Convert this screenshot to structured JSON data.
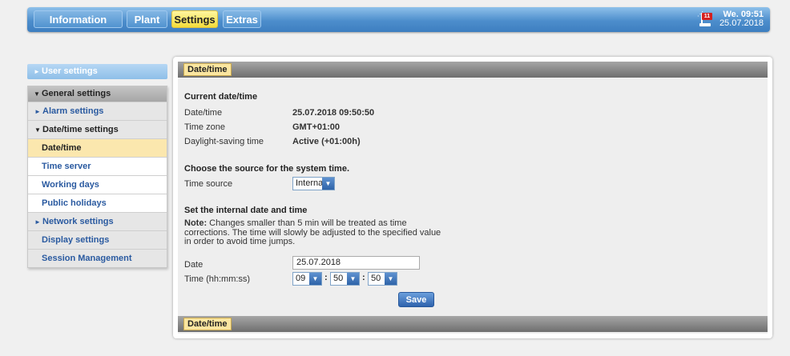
{
  "nav": {
    "tabs": [
      {
        "label": "Information"
      },
      {
        "label": "Plant"
      },
      {
        "label": "Settings"
      },
      {
        "label": "Extras"
      }
    ],
    "alarm_count": "11",
    "clock_time": "We. 09:51",
    "clock_date": "25.07.2018"
  },
  "sidebar": {
    "user_settings": "User settings",
    "general_settings": "General settings",
    "alarm_settings": "Alarm settings",
    "datetime_settings": "Date/time settings",
    "datetime": "Date/time",
    "time_server": "Time server",
    "working_days": "Working days",
    "public_holidays": "Public holidays",
    "network_settings": "Network settings",
    "display_settings": "Display settings",
    "session_management": "Session Management"
  },
  "panel": {
    "tab_label": "Date/time",
    "current_heading": "Current date/time",
    "rows": [
      {
        "label": "Date/time",
        "value": "25.07.2018 09:50:50"
      },
      {
        "label": "Time zone",
        "value": "GMT+01:00"
      },
      {
        "label": "Daylight-saving time",
        "value": "Active (+01:00h)"
      }
    ],
    "source_heading": "Choose the source for the system time.",
    "time_source_label": "Time source",
    "time_source_value": "Internal",
    "set_heading": "Set the internal date and time",
    "note_bold": "Note:",
    "note_text": "Changes smaller than 5 min will be treated as time corrections. The time will slowly be adjusted to the specified value in order to avoid time jumps.",
    "date_label": "Date",
    "date_value": "25.07.2018",
    "time_label": "Time (hh:mm:ss)",
    "hh": "09",
    "mm": "50",
    "ss": "50",
    "save_label": "Save"
  },
  "colors": {
    "active_tab": "#f3dc3a",
    "nav_blue": "#4d8ecc",
    "link_blue": "#2a5aa0",
    "selected_row": "#fbe7ae"
  }
}
